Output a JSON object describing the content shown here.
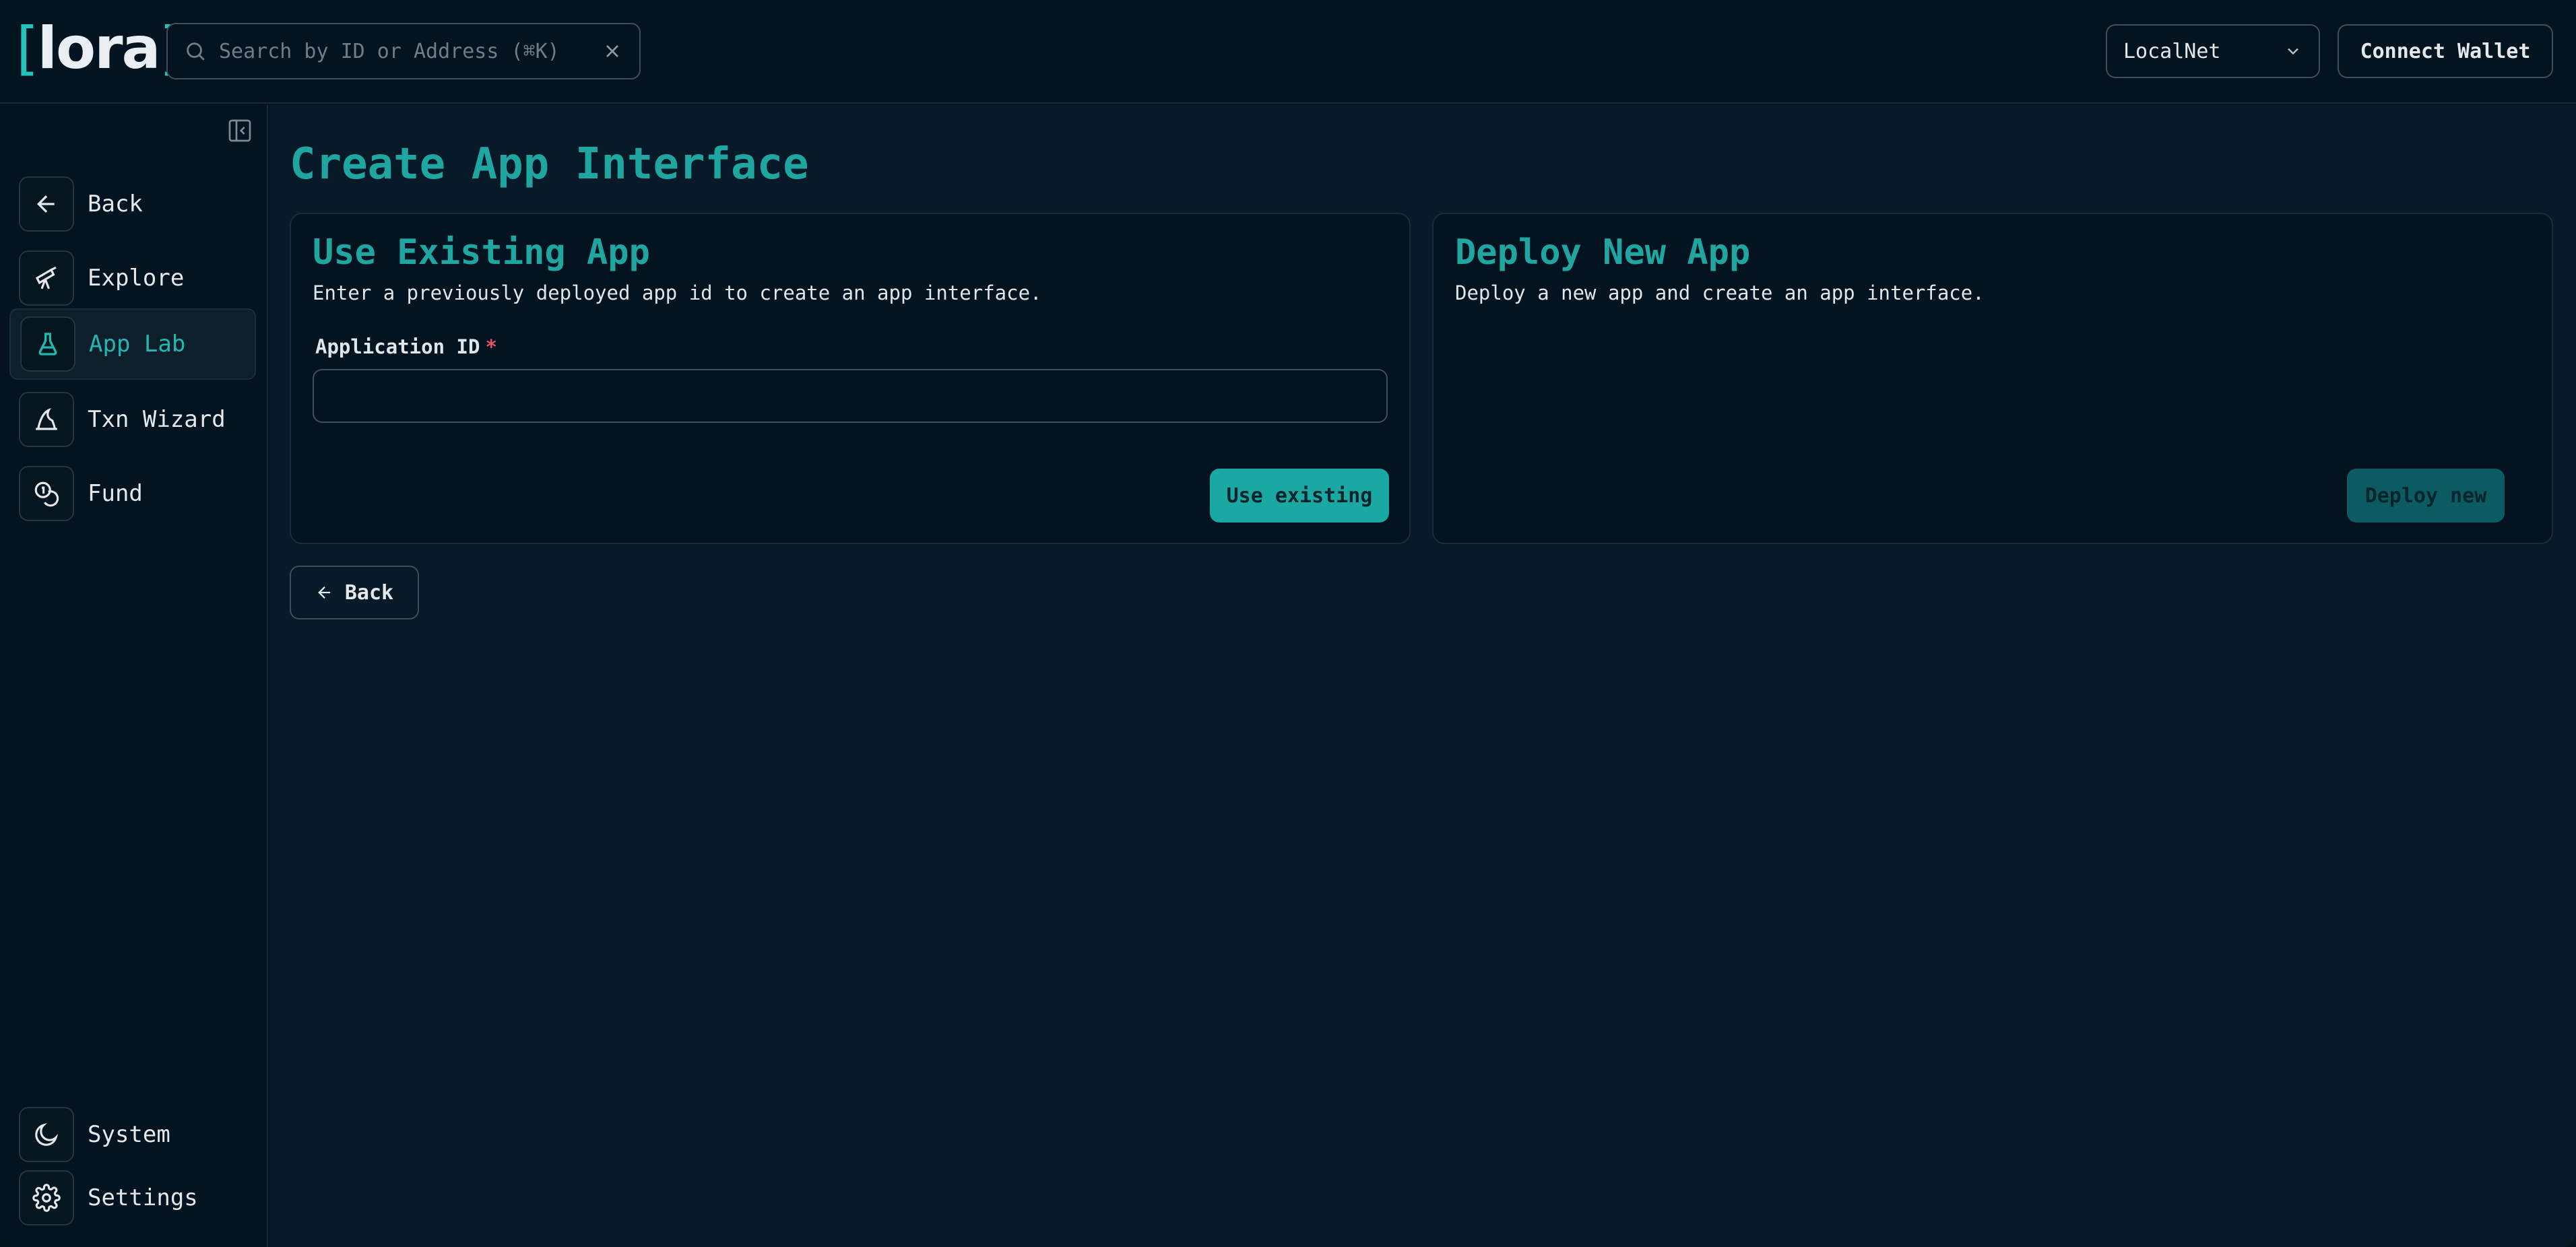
{
  "header": {
    "logo_left_bracket": "[",
    "logo_text": "lora",
    "logo_right_bracket": "]",
    "search_placeholder": "Search by ID or Address (⌘K)",
    "network": "LocalNet",
    "connect_label": "Connect Wallet"
  },
  "sidebar": {
    "items": [
      {
        "label": "Back",
        "icon": "arrow-left-icon"
      },
      {
        "label": "Explore",
        "icon": "telescope-icon"
      },
      {
        "label": "App Lab",
        "icon": "flask-icon"
      },
      {
        "label": "Txn Wizard",
        "icon": "wizard-hat-icon"
      },
      {
        "label": "Fund",
        "icon": "coins-icon"
      }
    ],
    "bottom": [
      {
        "label": "System",
        "icon": "moon-icon"
      },
      {
        "label": "Settings",
        "icon": "gear-icon"
      }
    ]
  },
  "main": {
    "title": "Create App Interface",
    "existing": {
      "title": "Use Existing App",
      "description": "Enter a previously deployed app id to create an app interface.",
      "field_label": "Application ID",
      "required_mark": "*",
      "field_value": "",
      "button": "Use existing"
    },
    "deploy": {
      "title": "Deploy New App",
      "description": "Deploy a new app and create an app interface.",
      "button": "Deploy new"
    },
    "back_label": "Back"
  },
  "colors": {
    "accent": "#1fa6a1",
    "background": "#04141f",
    "required": "#e45466"
  }
}
